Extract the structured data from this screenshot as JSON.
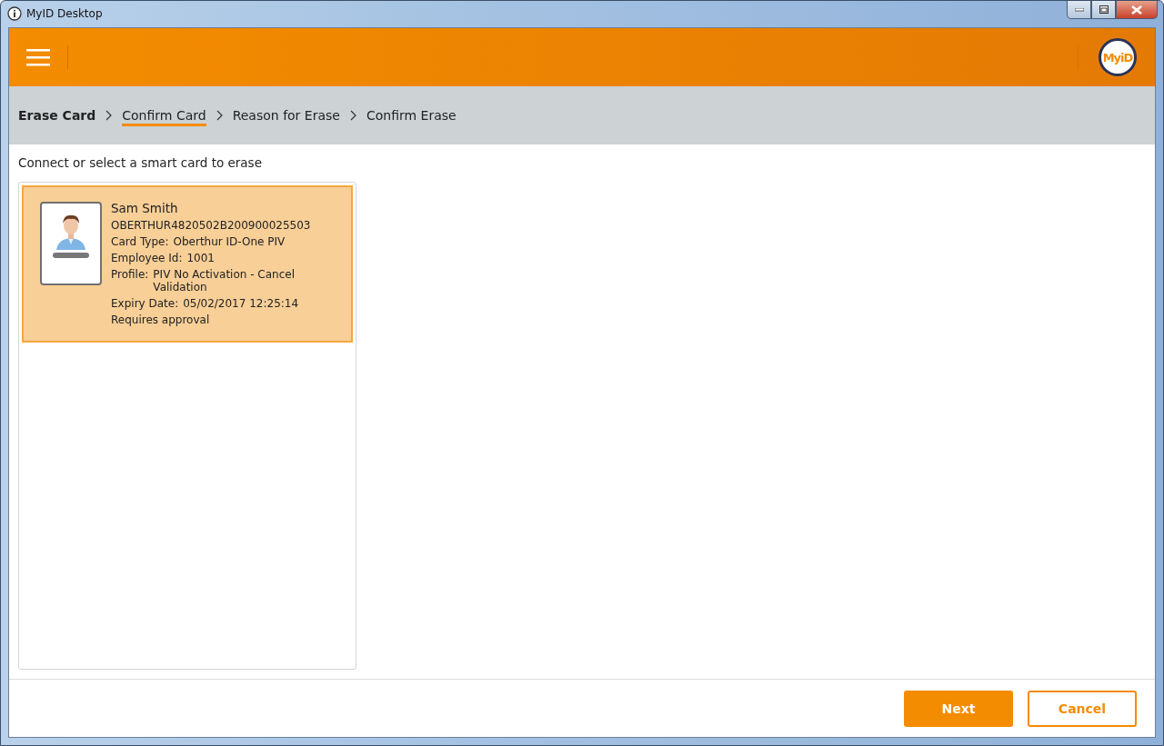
{
  "window": {
    "title": "MyID Desktop"
  },
  "header": {
    "logo": "MyiD"
  },
  "breadcrumb": {
    "title": "Erase Card",
    "steps": [
      {
        "label": "Confirm Card",
        "selected": true
      },
      {
        "label": "Reason for Erase",
        "selected": false
      },
      {
        "label": "Confirm Erase",
        "selected": false
      }
    ]
  },
  "instruction": "Connect or select a smart card to erase",
  "cards": [
    {
      "selected": true,
      "name": "Sam Smith",
      "serial": "OBERTHUR4820502B200900025503",
      "fields": [
        {
          "label": "Card Type:",
          "value": "Oberthur ID-One PIV"
        },
        {
          "label": "Employee Id:",
          "value": "1001"
        },
        {
          "label": "Profile:",
          "value": "PIV No Activation - Cancel Validation"
        },
        {
          "label": "Expiry Date:",
          "value": "05/02/2017 12:25:14"
        }
      ],
      "note": "Requires approval"
    }
  ],
  "buttons": [
    {
      "label": "Next",
      "kind": "primary"
    },
    {
      "label": "Cancel",
      "kind": "secondary"
    }
  ]
}
